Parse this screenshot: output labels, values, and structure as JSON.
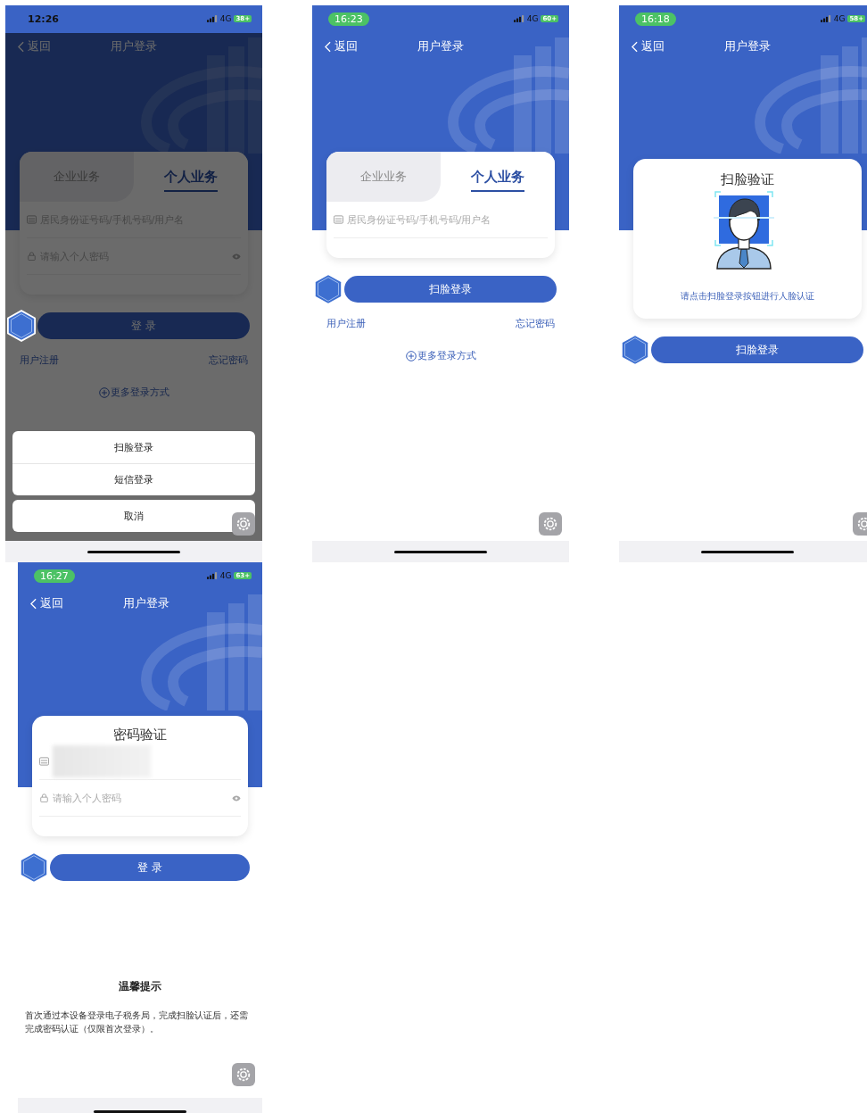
{
  "screens": [
    {
      "status": {
        "time": "12:26",
        "time_pill": false,
        "network": "4G",
        "battery": "38+"
      },
      "nav": {
        "back": "返回",
        "title": "用户登录"
      },
      "dimmed": true,
      "card": {
        "kind": "tabs",
        "tabs": [
          {
            "label": "企业业务",
            "selected": false
          },
          {
            "label": "个人业务",
            "selected": true
          }
        ],
        "fields": [
          {
            "kind": "account",
            "placeholder": "居民身份证号码/手机号码/用户名"
          },
          {
            "kind": "password",
            "placeholder": "请输入个人密码"
          }
        ]
      },
      "primary_button": "登 录",
      "links": [
        "用户注册",
        "忘记密码"
      ],
      "more_link": "更多登录方式",
      "action_sheet": {
        "options": [
          "扫脸登录",
          "短信登录"
        ],
        "cancel": "取消"
      }
    },
    {
      "status": {
        "time": "16:23",
        "time_pill": true,
        "network": "4G",
        "battery": "60+"
      },
      "nav": {
        "back": "返回",
        "title": "用户登录"
      },
      "dimmed": false,
      "card": {
        "kind": "tabs",
        "tabs": [
          {
            "label": "企业业务",
            "selected": false
          },
          {
            "label": "个人业务",
            "selected": true
          }
        ],
        "fields": [
          {
            "kind": "account",
            "placeholder": "居民身份证号码/手机号码/用户名"
          }
        ]
      },
      "primary_button": "扫脸登录",
      "links": [
        "用户注册",
        "忘记密码"
      ],
      "more_link": "更多登录方式"
    },
    {
      "status": {
        "time": "16:18",
        "time_pill": true,
        "network": "4G",
        "battery": "58+"
      },
      "nav": {
        "back": "返回",
        "title": "用户登录"
      },
      "dimmed": false,
      "card": {
        "kind": "face",
        "title": "扫脸验证",
        "hint": "请点击扫脸登录按钮进行人脸认证"
      },
      "primary_button": "扫脸登录"
    },
    {
      "status": {
        "time": "16:27",
        "time_pill": true,
        "network": "4G",
        "battery": "63+"
      },
      "nav": {
        "back": "返回",
        "title": "用户登录"
      },
      "dimmed": false,
      "card": {
        "kind": "password",
        "title": "密码验证",
        "fields": [
          {
            "kind": "account",
            "redacted": true
          },
          {
            "kind": "password",
            "placeholder": "请输入个人密码"
          }
        ]
      },
      "primary_button": "登 录",
      "tip": {
        "title": "温馨提示",
        "text": "首次通过本设备登录电子税务局，完成扫脸认证后，还需完成密码认证（仅限首次登录）。"
      }
    }
  ]
}
